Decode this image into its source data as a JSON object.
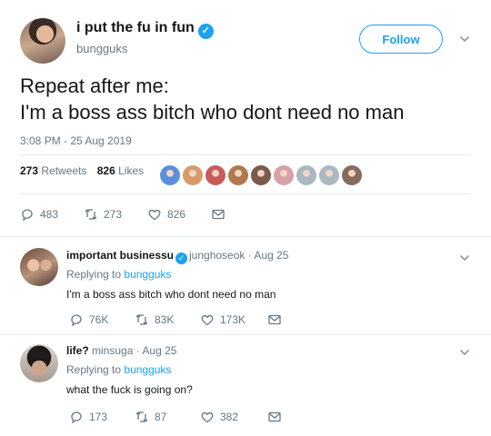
{
  "main_tweet": {
    "display_name": "i put the fu in fun",
    "handle": "bungguks",
    "follow_label": "Follow",
    "text_line1": "Repeat after me:",
    "text_line2": "I'm a boss ass bitch who dont need no man",
    "timestamp": "3:08 PM - 25 Aug 2019",
    "retweets_count": "273",
    "retweets_label": "Retweets",
    "likes_count": "826",
    "likes_label": "Likes",
    "liker_colors": [
      "#5b8fd9",
      "#d99a6b",
      "#c95b5b",
      "#b07a4f",
      "#7a5a4a",
      "#d8a0a8",
      "#aab8c2",
      "#aab8c2",
      "#8a6a5a"
    ],
    "actions": {
      "replies": "483",
      "retweets": "273",
      "likes": "826"
    }
  },
  "replies": [
    {
      "display_name": "important businessu",
      "handle": "junghoseok",
      "date": "Aug 25",
      "replying_label": "Replying to",
      "replying_to": "bungguks",
      "text": "I'm a boss ass bitch who dont need no man",
      "actions": {
        "replies": "76K",
        "retweets": "83K",
        "likes": "173K"
      }
    },
    {
      "display_name": "life?",
      "handle": "minsuga",
      "date": "Aug 25",
      "replying_label": "Replying to",
      "replying_to": "bungguks",
      "text": "what the fuck is going on?",
      "actions": {
        "replies": "173",
        "retweets": "87",
        "likes": "382"
      }
    }
  ],
  "colors": {
    "accent": "#1da1f2",
    "muted": "#657786",
    "text": "#14171a",
    "divider": "#e6ecf0"
  }
}
